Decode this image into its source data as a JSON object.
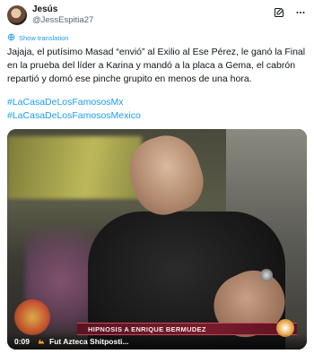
{
  "tweet": {
    "author": {
      "display_name": "Jesús",
      "handle": "@JessEspitia27"
    },
    "show_translation": "Show translation",
    "text": "Jajaja, el putísimo Masad “envió” al Exilio al Ese Pérez, le ganó la Final en la prueba del líder a Karina y mandó a la placa a Gema, el cabrón repartió y domó ese pinche grupito en menos de una hora.",
    "hashtags": [
      "#LaCasaDeLosFamososMx",
      "#LaCasaDeLosFamososMexico"
    ]
  },
  "video": {
    "lower_third": "HIPNOSIS A ENRIQUE BERMUDEZ",
    "timestamp": "0:09",
    "source": "Fut Azteca Shitposti..."
  },
  "icons": {
    "edit": "edit-note-icon",
    "more": "more-icon",
    "translate": "translate-icon",
    "source": "source-icon"
  },
  "colors": {
    "link": "#1d9bf0",
    "text": "#0f1419",
    "secondary": "#536471"
  }
}
